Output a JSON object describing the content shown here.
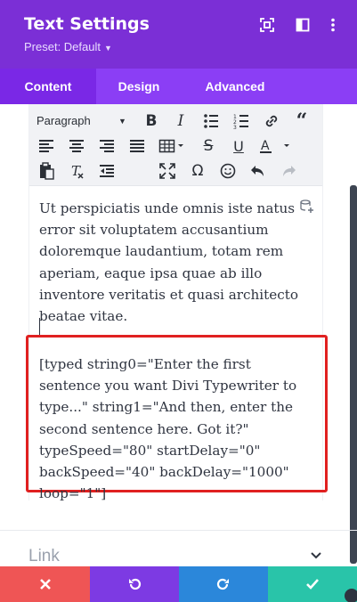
{
  "header": {
    "title": "Text Settings",
    "preset_label": "Preset: Default",
    "icons": [
      "focus-icon",
      "sidebar-toggle-icon",
      "more-options-icon"
    ]
  },
  "tabs": [
    {
      "label": "Content",
      "active": true
    },
    {
      "label": "Design",
      "active": false
    },
    {
      "label": "Advanced",
      "active": false
    }
  ],
  "toolbar": {
    "format_select": "Paragraph",
    "row1_icons": [
      "bold-icon",
      "italic-icon",
      "bulleted-list-icon",
      "numbered-list-icon",
      "link-icon",
      "quote-icon"
    ],
    "row2_icons": [
      "align-left-icon",
      "align-center-icon",
      "align-right-icon",
      "justify-icon",
      "table-icon",
      "strikethrough-icon",
      "underline-icon",
      "text-color-icon"
    ],
    "row3_icons": [
      "paste-icon",
      "clear-formatting-icon",
      "outdent-icon",
      "fullscreen-icon",
      "special-character-icon",
      "emoji-icon",
      "undo-icon",
      "redo-icon"
    ]
  },
  "editor": {
    "body_text": "Ut perspiciatis unde omnis iste natus error sit voluptatem accusantium doloremque laudantium, totam rem aperiam, eaque ipsa quae ab illo inventore veritatis et quasi architecto beatae vitae.",
    "shortcode_text": "[typed string0=\"Enter the first sentence you want Divi Typewriter to type...\" string1=\"And then, enter the second sentence here. Got it?\" typeSpeed=\"80\" startDelay=\"0\" backSpeed=\"40\" backDelay=\"1000\" loop=\"1\"]"
  },
  "sections": {
    "link_label": "Link"
  },
  "footer": {
    "buttons": [
      "discard-icon",
      "undo-icon",
      "redo-icon",
      "save-icon"
    ]
  },
  "colors": {
    "header_bg": "#7b2fd6",
    "tabs_bg": "#8b3ef5",
    "highlight_border": "#e02020",
    "discard": "#ef5555",
    "undo": "#7d3ae3",
    "redo": "#2b87da",
    "save": "#29c4a9"
  }
}
